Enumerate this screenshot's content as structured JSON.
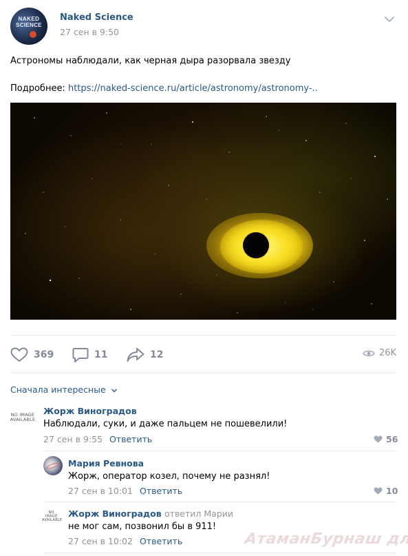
{
  "header": {
    "group_name": "Naked Science",
    "date": "27 сен в 9:50",
    "avatar_line1": "NAKED",
    "avatar_line2": "SCIENCE"
  },
  "post": {
    "text": "Астрономы наблюдали, как черная дыра разорвала звезду",
    "more_label": "Подробнее: ",
    "link_text": "https://naked-science.ru/article/astronomy/astronomy-.."
  },
  "actions": {
    "likes": "369",
    "comments": "11",
    "shares": "12",
    "views": "26K"
  },
  "comments_section": {
    "sort_label": "Сначала интересные",
    "reply_label": "Ответить",
    "no_image_l1": "NO IMAGE",
    "no_image_l2": "AVAILABLE"
  },
  "comments": [
    {
      "author": "Жорж Виноградов",
      "text": "Наблюдали, суки, и даже пальцем не пошевелили!",
      "date": "27 сен в 9:55",
      "likes": "56"
    },
    {
      "author": "Мария Ревнова",
      "text": "Жорж, оператор козел, почему не разнял!",
      "date": "27 сен в 10:01",
      "likes": "10"
    },
    {
      "author": "Жорж Виноградов",
      "reply_to": "ответил Марии",
      "text": "не мог сам, позвонил бы в 911!",
      "date": "27 сен в 10:02"
    }
  ],
  "watermark": "АтаманБурнаш для ЯП",
  "colors": {
    "link": "#2a5885",
    "muted": "#939393",
    "action": "#828a99",
    "divider": "#e7e8ec"
  }
}
